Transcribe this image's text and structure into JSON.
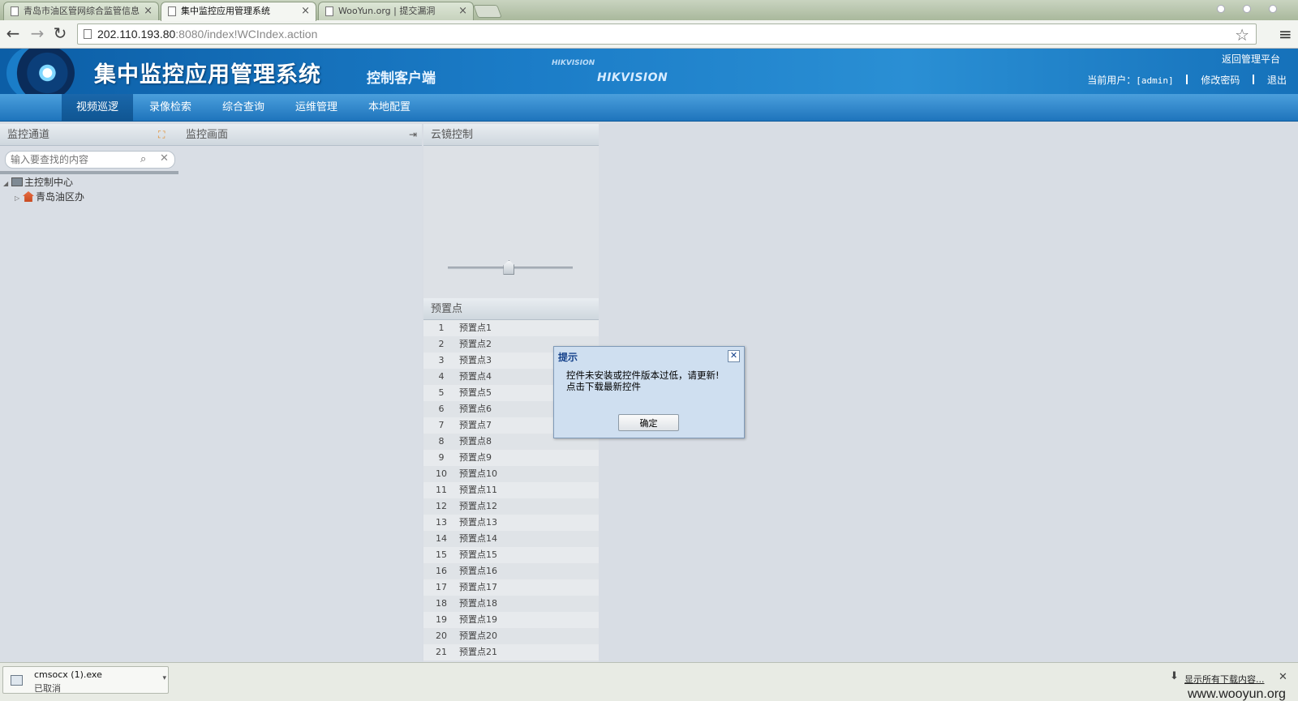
{
  "browser": {
    "tabs": [
      {
        "title": "青岛市油区管网综合监管信息"
      },
      {
        "title": "集中监控应用管理系统"
      },
      {
        "title": "WooYun.org | 提交漏洞"
      }
    ],
    "url_host": "202.110.193.80",
    "url_rest": ":8080/index!WCIndex.action"
  },
  "header": {
    "title": "集中监控应用管理系统",
    "subtitle": "控制客户端",
    "brand": "HIKVISION",
    "brand_small": "HIKVISION",
    "return_link": "返回管理平台",
    "current_user_label": "当前用户：",
    "current_user": "[admin]",
    "change_password": "修改密码",
    "logout": "退出"
  },
  "nav": {
    "items": [
      "视频巡逻",
      "录像检索",
      "综合查询",
      "运维管理",
      "本地配置"
    ],
    "active_index": 0
  },
  "left_panel": {
    "title": "监控通道",
    "search_placeholder": "输入要查找的内容",
    "tree": [
      {
        "label": "主控制中心",
        "expanded": true
      },
      {
        "label": "青岛油区办",
        "expanded": false
      }
    ]
  },
  "mid_panel": {
    "title": "监控画面"
  },
  "ptz_panel": {
    "title": "云镜控制",
    "slider_value_fraction": 0.49,
    "preset_title": "预置点",
    "presets": [
      {
        "num": "1",
        "name": "预置点1"
      },
      {
        "num": "2",
        "name": "预置点2"
      },
      {
        "num": "3",
        "name": "预置点3"
      },
      {
        "num": "4",
        "name": "预置点4"
      },
      {
        "num": "5",
        "name": "预置点5"
      },
      {
        "num": "6",
        "name": "预置点6"
      },
      {
        "num": "7",
        "name": "预置点7"
      },
      {
        "num": "8",
        "name": "预置点8"
      },
      {
        "num": "9",
        "name": "预置点9"
      },
      {
        "num": "10",
        "name": "预置点10"
      },
      {
        "num": "11",
        "name": "预置点11"
      },
      {
        "num": "12",
        "name": "预置点12"
      },
      {
        "num": "13",
        "name": "预置点13"
      },
      {
        "num": "14",
        "name": "预置点14"
      },
      {
        "num": "15",
        "name": "预置点15"
      },
      {
        "num": "16",
        "name": "预置点16"
      },
      {
        "num": "17",
        "name": "预置点17"
      },
      {
        "num": "18",
        "name": "预置点18"
      },
      {
        "num": "19",
        "name": "预置点19"
      },
      {
        "num": "20",
        "name": "预置点20"
      },
      {
        "num": "21",
        "name": "预置点21"
      }
    ]
  },
  "dialog": {
    "title": "提示",
    "message_line1": "控件未安装或控件版本过低，请更新!",
    "message_line2": "点击下载最新控件",
    "ok_label": "确定"
  },
  "download_bar": {
    "file_name": "cmsocx (1).exe",
    "status": "已取消",
    "show_all": "显示所有下载内容...",
    "watermark": "www.wooyun.org"
  },
  "colors": {
    "header_blue": "#1b7cc7",
    "nav_active": "#0f5592",
    "dialog_bg": "#cfdff0"
  }
}
